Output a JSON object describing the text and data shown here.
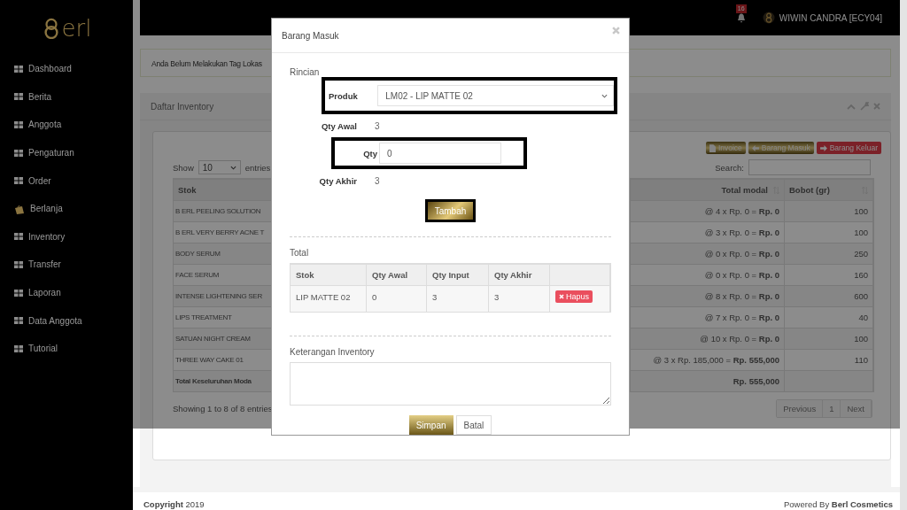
{
  "sidebar": {
    "logo_text": "erl",
    "items": [
      {
        "label": "Dashboard",
        "kind": "grid"
      },
      {
        "label": "Berita",
        "kind": "grid"
      },
      {
        "label": "Anggota",
        "kind": "grid"
      },
      {
        "label": "Pengaturan",
        "kind": "grid"
      },
      {
        "label": "Order",
        "kind": "grid"
      },
      {
        "label": "Berlanja",
        "kind": "bag"
      },
      {
        "label": "Inventory",
        "kind": "grid"
      },
      {
        "label": "Transfer",
        "kind": "grid"
      },
      {
        "label": "Laporan",
        "kind": "grid"
      },
      {
        "label": "Data Anggota",
        "kind": "grid"
      },
      {
        "label": "Tutorial",
        "kind": "grid"
      }
    ]
  },
  "header": {
    "notifications": "16",
    "user": "WIWIN CANDRA [ECY04]"
  },
  "alert": "Anda Belum Melakukan Tag Lokas",
  "panel": {
    "title": "Daftar Inventory",
    "toolbar": [
      {
        "label": "Invoice",
        "kind": "document"
      },
      {
        "label": "Barang Masuk",
        "kind": "incoming"
      },
      {
        "label": "Barang Keluar",
        "kind": "outgoing"
      }
    ],
    "show_label": "Show",
    "page_size": "10",
    "entries_label": "entries",
    "search_label": "Search:",
    "table": {
      "columns": [
        "Stok",
        "Total modal",
        "Bobot (gr)"
      ],
      "rows": [
        {
          "stok": "B ERL PEELING SOLUTION",
          "total_modal": "@ 4 x Rp. 0 = **Rp. 0**",
          "bobot": "100"
        },
        {
          "stok": "B ERL VERY BERRY ACNE T",
          "total_modal": "@ 3 x Rp. 0 = **Rp. 0**",
          "bobot": "100"
        },
        {
          "stok": "BODY SERUM",
          "total_modal": "@ 0 x Rp. 0 = **Rp. 0**",
          "bobot": "250"
        },
        {
          "stok": "FACE SERUM",
          "total_modal": "@ 0 x Rp. 0 = **Rp. 0**",
          "bobot": "160"
        },
        {
          "stok": "INTENSE LIGHTENING SER",
          "total_modal": "@ 8 x Rp. 0 = **Rp. 0**",
          "bobot": "600"
        },
        {
          "stok": "LIPS TREATMENT",
          "total_modal": "@ 7 x Rp. 0 = **Rp. 0**",
          "bobot": "40"
        },
        {
          "stok": "SATUAN NIGHT CREAM",
          "total_modal": "@ 10 x Rp. 0 = **Rp. 0**",
          "bobot": "100"
        },
        {
          "stok": "THREE WAY CAKE 01",
          "total_modal": "@ 3 x Rp. 185,000 = **Rp. 555,000**",
          "bobot": "110"
        }
      ],
      "total_row": {
        "label": "Total Keseluruhan Moda",
        "total": "Rp. 555,000"
      }
    },
    "info": "Showing 1 to 8 of 8 entries",
    "pagination": [
      "Previous",
      "1",
      "Next"
    ]
  },
  "modal": {
    "title": "Barang Masuk",
    "section": "Rincian",
    "product": {
      "label": "Produk",
      "value": "LM02 - LIP MATTE 02"
    },
    "qty_awal": {
      "label": "Qty Awal",
      "value": "3"
    },
    "qty": {
      "label": "Qty",
      "value": "0"
    },
    "qty_akhir": {
      "label": "Qty Akhir",
      "value": "3"
    },
    "add_button": "Tambah",
    "total_label": "Total",
    "table": {
      "columns": [
        "Stok",
        "Qty Awal",
        "Qty Input",
        "Qty Akhir"
      ],
      "rows": [
        {
          "cells": [
            "LIP MATTE 02",
            "0",
            "3",
            "3"
          ],
          "action": "Hapus"
        }
      ]
    },
    "notes_label": "Keterangan Inventory",
    "buttons": [
      {
        "label": "Simpan",
        "kind": "primary"
      },
      {
        "label": "Batal",
        "kind": "default"
      }
    ]
  },
  "footer": {
    "copyright": "**Copyright** 2019",
    "powered": "Powered By **Berl Cosmetics**"
  }
}
